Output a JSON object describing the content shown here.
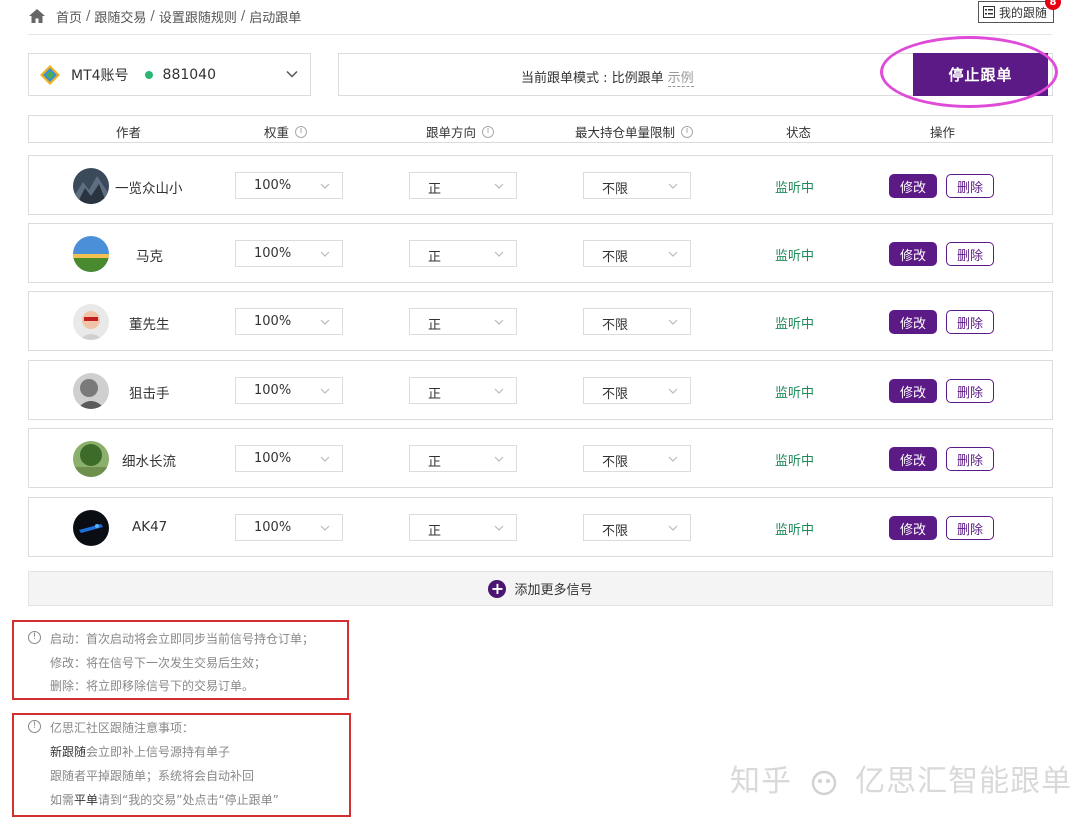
{
  "breadcrumb": {
    "items": [
      "首页",
      "跟随交易",
      "设置跟随规则",
      "启动跟单"
    ],
    "separator": "/"
  },
  "my_follow": {
    "label": "我的跟随",
    "badge": "8"
  },
  "account": {
    "label": "MT4账号",
    "number": "881040",
    "status_color": "#2bb673"
  },
  "mode": {
    "text": "当前跟单模式 : 比例跟单",
    "link": "示例"
  },
  "stop_button": {
    "label": "停止跟单",
    "color": "#5c1a87"
  },
  "table": {
    "headers": [
      "作者",
      "权重",
      "跟单方向",
      "最大持仓单量限制",
      "状态",
      "操作"
    ],
    "rows": [
      {
        "author": "一览众山小",
        "avatar": "avatar-mountain",
        "weight": "100%",
        "direction": "正",
        "max": "不限",
        "status": "监听中",
        "edit": "修改",
        "delete": "删除"
      },
      {
        "author": "马克",
        "avatar": "avatar-landscape",
        "weight": "100%",
        "direction": "正",
        "max": "不限",
        "status": "监听中",
        "edit": "修改",
        "delete": "删除"
      },
      {
        "author": "董先生",
        "avatar": "avatar-person",
        "weight": "100%",
        "direction": "正",
        "max": "不限",
        "status": "监听中",
        "edit": "修改",
        "delete": "删除"
      },
      {
        "author": "狙击手",
        "avatar": "avatar-bw",
        "weight": "100%",
        "direction": "正",
        "max": "不限",
        "status": "监听中",
        "edit": "修改",
        "delete": "删除"
      },
      {
        "author": "细水长流",
        "avatar": "avatar-tree",
        "weight": "100%",
        "direction": "正",
        "max": "不限",
        "status": "监听中",
        "edit": "修改",
        "delete": "删除"
      },
      {
        "author": "AK47",
        "avatar": "avatar-dark",
        "weight": "100%",
        "direction": "正",
        "max": "不限",
        "status": "监听中",
        "edit": "修改",
        "delete": "删除"
      }
    ]
  },
  "add_more": {
    "label": "添加更多信号"
  },
  "notes1": [
    "启动：首次启动将会立即同步当前信号持仓订单；",
    "修改：将在信号下一次发生交易后生效；",
    "删除：将立即移除信号下的交易订单。"
  ],
  "notes2": {
    "title": "亿思汇社区跟随注意事项：",
    "line1_dark": "新跟随",
    "line1_rest": "会立即补上信号源持有单子",
    "line2": "跟随者平掉跟随单；系统将会自动补回",
    "line3_a": "如需",
    "line3_dark": "平单",
    "line3_b": "请到“我的交易”处点击“停止跟单”"
  },
  "watermark": {
    "text_a": "知乎",
    "text_b": "亿思汇智能跟单"
  }
}
